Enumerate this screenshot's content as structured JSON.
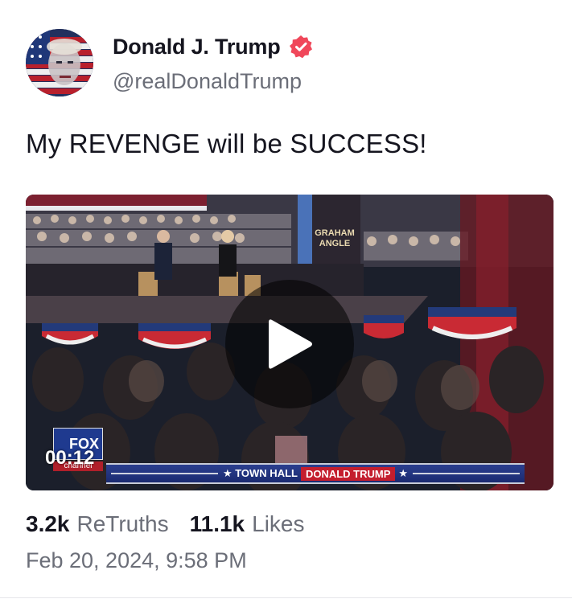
{
  "post": {
    "author": {
      "display_name": "Donald J. Trump",
      "handle": "@realDonaldTrump",
      "verified_icon": "verified-badge-icon",
      "avatar": "avatar-image"
    },
    "text": "My REVENGE will be SUCCESS!",
    "media": {
      "type": "video",
      "duration": "00:12",
      "play_icon": "play-icon",
      "channel_logo_top": "FOX",
      "channel_logo_bottom": "channel",
      "banner_prefix": "★ TOWN HALL",
      "banner_tag": "DONALD TRUMP",
      "banner_suffix": "★",
      "set_sign_line1": "GRAHAM",
      "set_sign_line2": "ANGLE"
    },
    "stats": {
      "retruths_count": "3.2k",
      "retruths_label": "ReTruths",
      "likes_count": "11.1k",
      "likes_label": "Likes"
    },
    "date": "Feb 20, 2024, 9:58 PM"
  },
  "colors": {
    "verified": "#f0475a",
    "text": "#15151f",
    "muted": "#6b6e78"
  }
}
